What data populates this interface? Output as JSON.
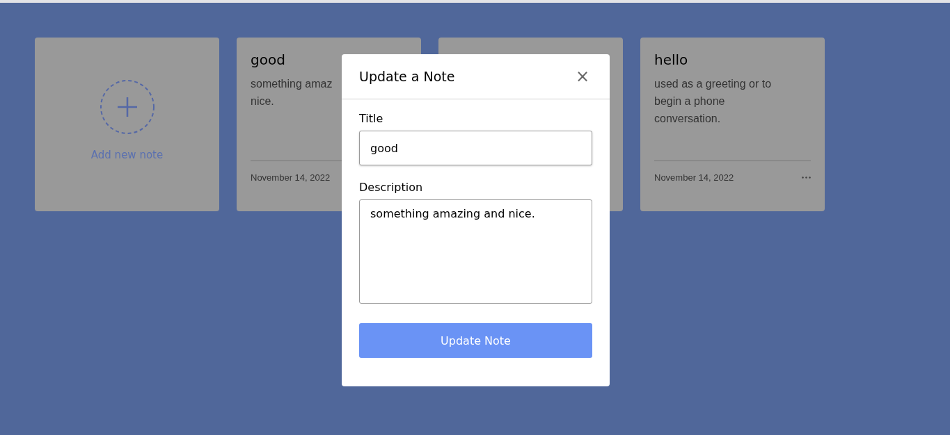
{
  "cards": [
    {
      "kind": "add",
      "label": "Add new note"
    },
    {
      "kind": "note",
      "title": "good",
      "description_lines": [
        "something amaz",
        "nice."
      ],
      "date": "November 14, 2022"
    },
    {
      "kind": "note"
    },
    {
      "kind": "note",
      "title": "hello",
      "description_lines": [
        "used as a greeting or to",
        "begin a phone",
        "conversation."
      ],
      "date": "November 14, 2022",
      "menu": true
    }
  ],
  "modal": {
    "title": "Update a Note",
    "close": "×",
    "fields": [
      {
        "kind": "input",
        "label": "Title",
        "value": "good"
      },
      {
        "kind": "textarea",
        "label": "Description",
        "value": "something amazing and nice."
      }
    ],
    "button": "Update Note"
  }
}
